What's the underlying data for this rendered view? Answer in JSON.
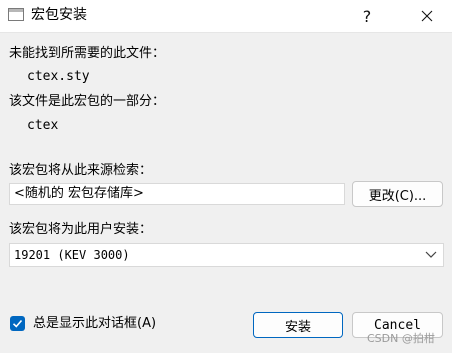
{
  "window": {
    "title": "宏包安装",
    "help_label": "?",
    "close_label": "✕"
  },
  "missing": {
    "heading": "未能找到所需要的此文件：",
    "file": "ctex.sty",
    "package_heading": "该文件是此宏包的一部分：",
    "package": "ctex"
  },
  "source": {
    "label": "该宏包将从此来源检索：",
    "value": "<随机的 宏包存储库>",
    "change_label": "更改(C)..."
  },
  "install_for": {
    "label": "该宏包将为此用户安装：",
    "selected": "19201 (KEV 3000)"
  },
  "footer": {
    "always_show_label": "总是显示此对话框(A)",
    "always_show_checked": true,
    "install_label": "安装",
    "cancel_label": "Cancel"
  },
  "watermark": "CSDN @拍柑",
  "colors": {
    "accent": "#0067c0",
    "background": "#f0f0f0"
  },
  "icons": {
    "app": "window-icon",
    "dropdown": "chevron-down-icon",
    "check": "check-icon"
  }
}
